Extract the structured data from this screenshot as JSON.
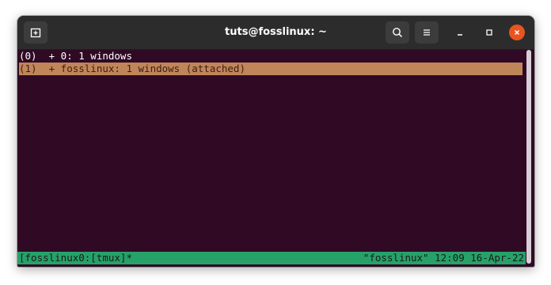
{
  "window": {
    "title": "tuts@fosslinux: ~"
  },
  "titlebar": {
    "buttons": {
      "new_tab": "new-tab-icon",
      "search": "search-icon",
      "menu": "hamburger-menu-icon",
      "minimize": "minimize-icon",
      "maximize": "maximize-icon",
      "close": "close-icon"
    },
    "close_color": "#e95420"
  },
  "terminal": {
    "background": "#300a24",
    "lines": [
      "(0)  + 0: 1 windows",
      "(1)  + fosslinux: 1 windows (attached)"
    ],
    "selected_line_color": "#c1855a"
  },
  "status": {
    "left": "[fosslinux0:[tmux]*",
    "right": "\"fosslinux\" 12:09 16-Apr-22",
    "color": "#26a269"
  }
}
